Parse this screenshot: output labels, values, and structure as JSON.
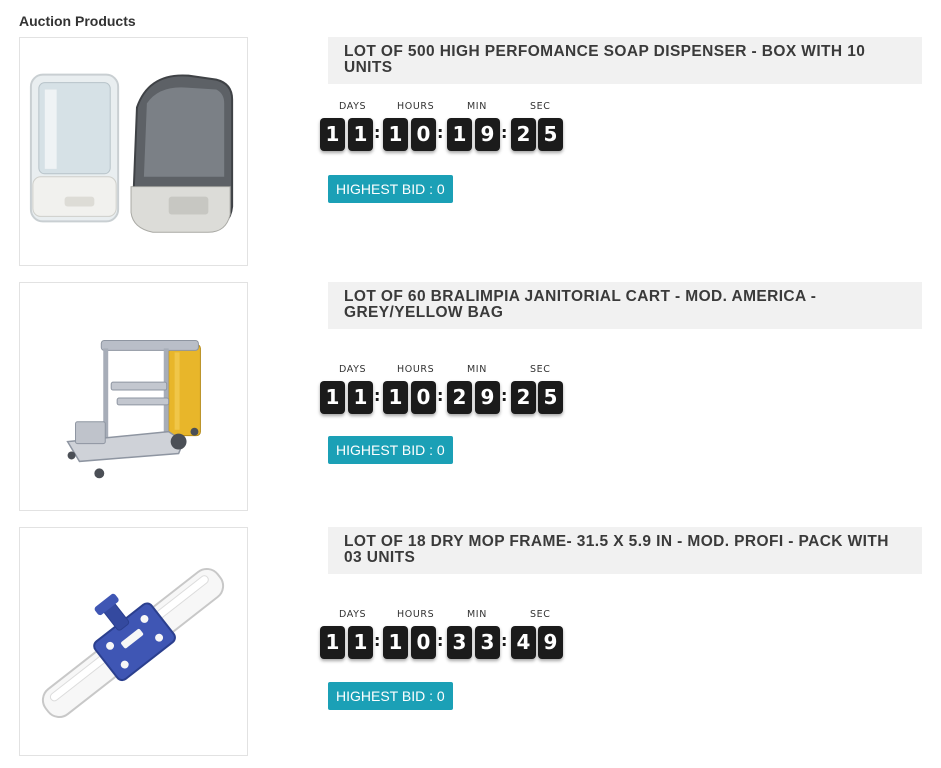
{
  "section": {
    "title": "Auction Products"
  },
  "countdown_labels": {
    "days": "DAYS",
    "hours": "HOURS",
    "min": "MIN",
    "sec": "SEC"
  },
  "products": [
    {
      "title": "LOT OF 500 HIGH PERFOMANCE SOAP DISPENSER - BOX WITH 10 UNITS",
      "image": "soap-dispenser-image",
      "digits": [
        "1",
        "1",
        "1",
        "0",
        "1",
        "9",
        "2",
        "5"
      ],
      "bid_label": "HIGHEST BID : 0"
    },
    {
      "title": "LOT OF 60 BRALIMPIA JANITORIAL CART - MOD. AMERICA - GREY/YELLOW BAG",
      "image": "janitorial-cart-image",
      "digits": [
        "1",
        "1",
        "1",
        "0",
        "2",
        "9",
        "2",
        "5"
      ],
      "bid_label": "HIGHEST BID : 0"
    },
    {
      "title": "LOT OF 18 DRY MOP FRAME- 31.5 X 5.9 IN - MOD. PROFI - PACK WITH 03 UNITS",
      "image": "mop-frame-image",
      "digits": [
        "1",
        "1",
        "1",
        "0",
        "3",
        "3",
        "4",
        "9"
      ],
      "bid_label": "HIGHEST BID : 0"
    }
  ],
  "colors": {
    "bid_button": "#1ba0b6",
    "digit_bg": "#1b1b1b",
    "title_bg": "#f1f1f1"
  }
}
